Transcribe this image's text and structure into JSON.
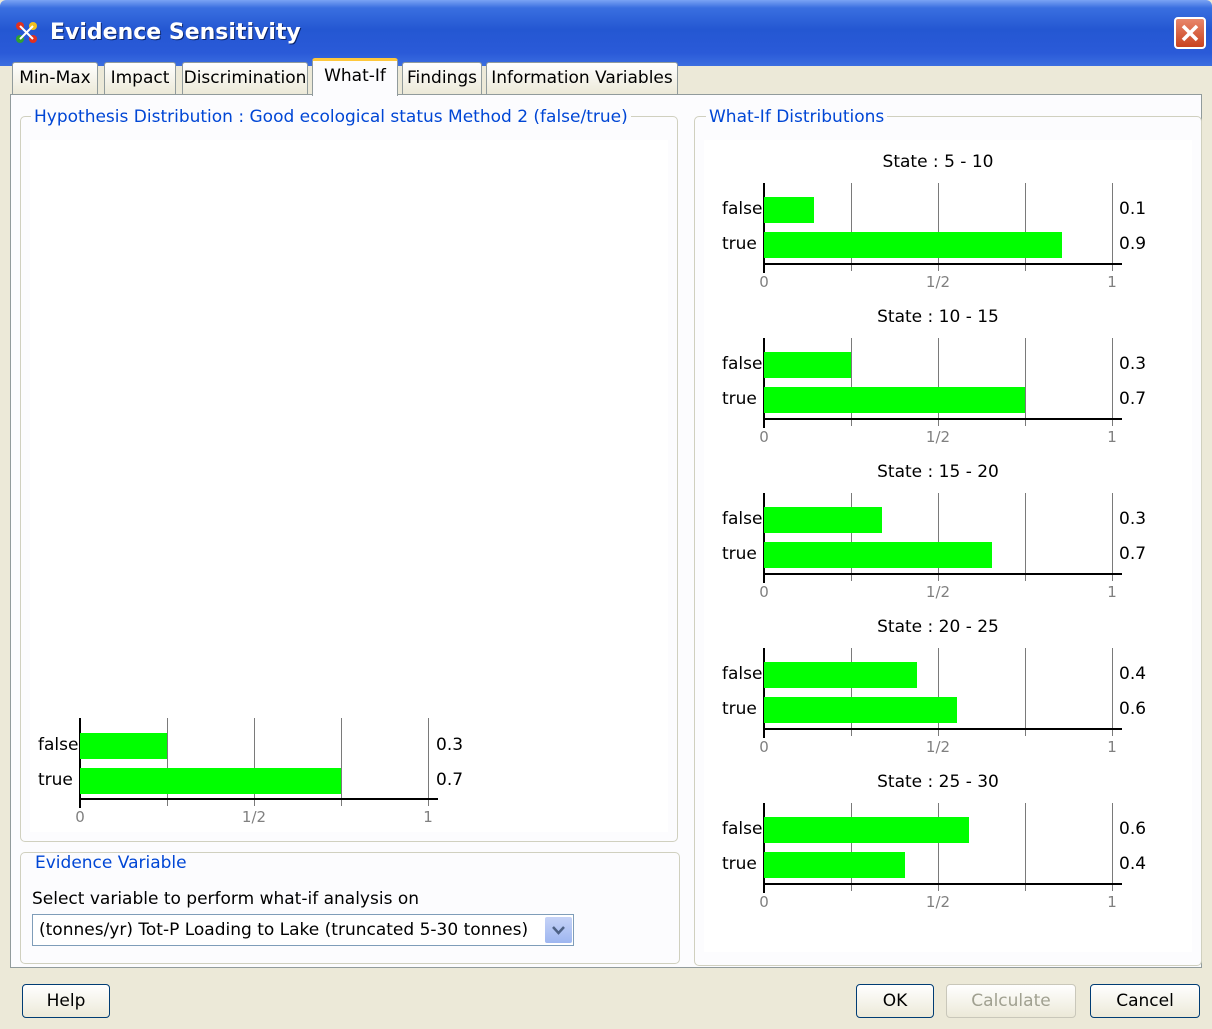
{
  "window": {
    "title": "Evidence Sensitivity"
  },
  "tabs": [
    {
      "label": "Min-Max"
    },
    {
      "label": "Impact"
    },
    {
      "label": "Discrimination"
    },
    {
      "label": "What-If"
    },
    {
      "label": "Findings"
    },
    {
      "label": "Information Variables"
    }
  ],
  "hypothesis": {
    "legend": "Hypothesis Distribution : Good ecological status  Method 2 (false/true)"
  },
  "whatif": {
    "legend": "What-If Distributions"
  },
  "evidence": {
    "legend": "Evidence Variable",
    "prompt": "Select variable to perform what-if analysis on",
    "selected": "(tonnes/yr) Tot-P Loading  to Lake (truncated 5-30 tonnes)"
  },
  "buttons": {
    "help": "Help",
    "ok": "OK",
    "calculate": "Calculate",
    "cancel": "Cancel"
  },
  "chart_data": [
    {
      "type": "bar",
      "title": "",
      "categories": [
        "false",
        "true"
      ],
      "values": [
        0.25,
        0.75
      ],
      "value_labels": [
        "0.3",
        "0.7"
      ],
      "xticks": [
        "0",
        "1/2",
        "1"
      ],
      "xlim": [
        0,
        1
      ],
      "bar_color": "#00ff00"
    },
    {
      "type": "bar",
      "title": "State : 5 - 10",
      "categories": [
        "false",
        "true"
      ],
      "values": [
        0.145,
        0.855
      ],
      "value_labels": [
        "0.1",
        "0.9"
      ],
      "xticks": [
        "0",
        "1/2",
        "1"
      ],
      "xlim": [
        0,
        1
      ],
      "bar_color": "#00ff00"
    },
    {
      "type": "bar",
      "title": "State : 10 - 15",
      "categories": [
        "false",
        "true"
      ],
      "values": [
        0.25,
        0.75
      ],
      "value_labels": [
        "0.3",
        "0.7"
      ],
      "xticks": [
        "0",
        "1/2",
        "1"
      ],
      "xlim": [
        0,
        1
      ],
      "bar_color": "#00ff00"
    },
    {
      "type": "bar",
      "title": "State : 15 - 20",
      "categories": [
        "false",
        "true"
      ],
      "values": [
        0.34,
        0.655
      ],
      "value_labels": [
        "0.3",
        "0.7"
      ],
      "xticks": [
        "0",
        "1/2",
        "1"
      ],
      "xlim": [
        0,
        1
      ],
      "bar_color": "#00ff00"
    },
    {
      "type": "bar",
      "title": "State : 20 - 25",
      "categories": [
        "false",
        "true"
      ],
      "values": [
        0.44,
        0.555
      ],
      "value_labels": [
        "0.4",
        "0.6"
      ],
      "xticks": [
        "0",
        "1/2",
        "1"
      ],
      "xlim": [
        0,
        1
      ],
      "bar_color": "#00ff00"
    },
    {
      "type": "bar",
      "title": "State : 25 - 30",
      "categories": [
        "false",
        "true"
      ],
      "values": [
        0.59,
        0.405
      ],
      "value_labels": [
        "0.6",
        "0.4"
      ],
      "xticks": [
        "0",
        "1/2",
        "1"
      ],
      "xlim": [
        0,
        1
      ],
      "bar_color": "#00ff00"
    }
  ]
}
